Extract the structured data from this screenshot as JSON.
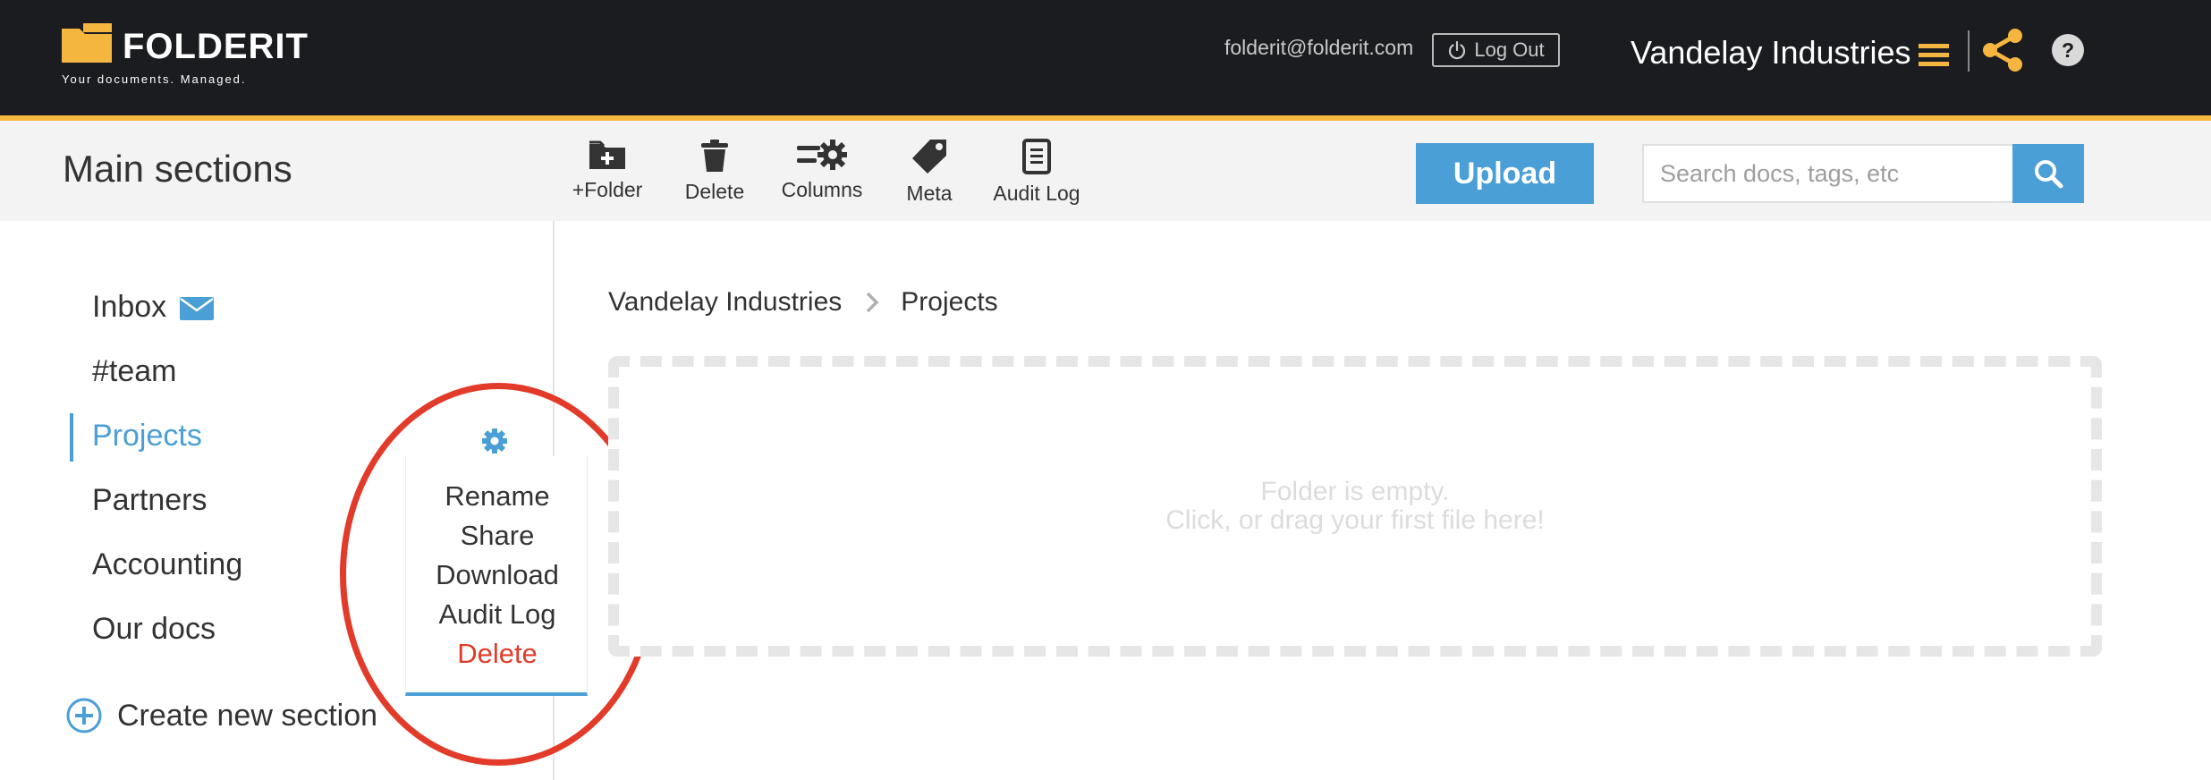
{
  "header": {
    "logo_text": "FOLDERIT",
    "logo_tagline": "Your documents. Managed.",
    "user_email": "folderit@folderit.com",
    "logout_label": "Log Out",
    "org_name": "Vandelay Industries",
    "help_label": "?"
  },
  "toolbar": {
    "section_title": "Main sections",
    "tools": [
      {
        "label": "+Folder",
        "icon": "folder-plus-icon"
      },
      {
        "label": "Delete",
        "icon": "trash-icon"
      },
      {
        "label": "Columns",
        "icon": "columns-settings-icon"
      },
      {
        "label": "Meta",
        "icon": "tag-icon"
      },
      {
        "label": "Audit Log",
        "icon": "document-list-icon"
      }
    ],
    "upload_label": "Upload",
    "search_placeholder": "Search docs, tags, etc"
  },
  "sidebar": {
    "items": [
      {
        "label": "Inbox",
        "active": false
      },
      {
        "label": "#team",
        "active": false
      },
      {
        "label": "Projects",
        "active": true
      },
      {
        "label": "Partners",
        "active": false
      },
      {
        "label": "Accounting",
        "active": false
      },
      {
        "label": "Our docs",
        "active": false
      }
    ],
    "create_label": "Create new section"
  },
  "context_menu": {
    "items": [
      {
        "label": "Rename"
      },
      {
        "label": "Share"
      },
      {
        "label": "Download"
      },
      {
        "label": "Audit Log"
      },
      {
        "label": "Delete",
        "danger": true
      }
    ]
  },
  "breadcrumb": {
    "items": [
      "Vandelay Industries",
      "Projects"
    ]
  },
  "dropzone": {
    "line1": "Folder is empty.",
    "line2": "Click, or drag your first file here!"
  },
  "colors": {
    "accent_blue": "#4a9fd6",
    "brand_yellow": "#f4b63f",
    "header_bg": "#1a1c20",
    "danger_red": "#e23b2a"
  }
}
